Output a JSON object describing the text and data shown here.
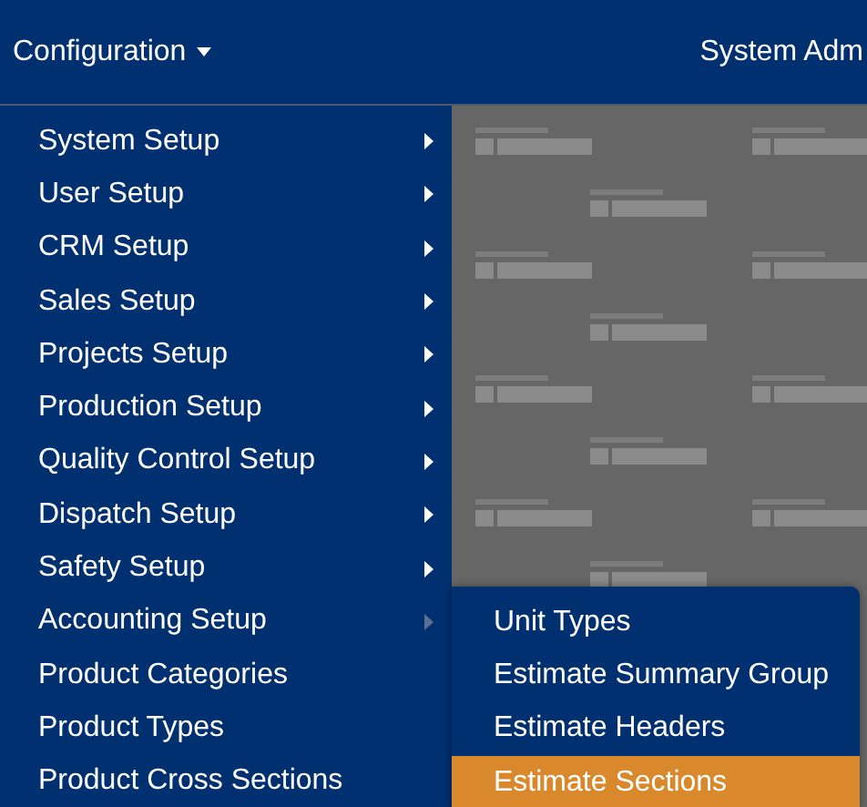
{
  "navbar": {
    "menu": {
      "label": "Configuration",
      "expanded": true
    },
    "user": {
      "label": "System Adm"
    }
  },
  "menu_items": [
    {
      "label": "System Setup",
      "has_submenu": true,
      "expanded": false
    },
    {
      "label": "User Setup",
      "has_submenu": true,
      "expanded": false
    },
    {
      "label": "CRM Setup",
      "has_submenu": true,
      "expanded": false
    },
    {
      "label": "Sales Setup",
      "has_submenu": true,
      "expanded": false
    },
    {
      "label": "Projects Setup",
      "has_submenu": true,
      "expanded": false
    },
    {
      "label": "Production Setup",
      "has_submenu": true,
      "expanded": false
    },
    {
      "label": "Quality Control Setup",
      "has_submenu": true,
      "expanded": false
    },
    {
      "label": "Dispatch Setup",
      "has_submenu": true,
      "expanded": false
    },
    {
      "label": "Safety Setup",
      "has_submenu": true,
      "expanded": false
    },
    {
      "label": "Accounting Setup",
      "has_submenu": true,
      "expanded": true
    },
    {
      "label": "Product Categories",
      "has_submenu": false
    },
    {
      "label": "Product Types",
      "has_submenu": false
    },
    {
      "label": "Product Cross Sections",
      "has_submenu": false
    }
  ],
  "submenu_items": [
    {
      "label": "Unit Types",
      "selected": false
    },
    {
      "label": "Estimate Summary Group",
      "selected": false
    },
    {
      "label": "Estimate Headers",
      "selected": false
    },
    {
      "label": "Estimate Sections",
      "selected": true
    }
  ]
}
